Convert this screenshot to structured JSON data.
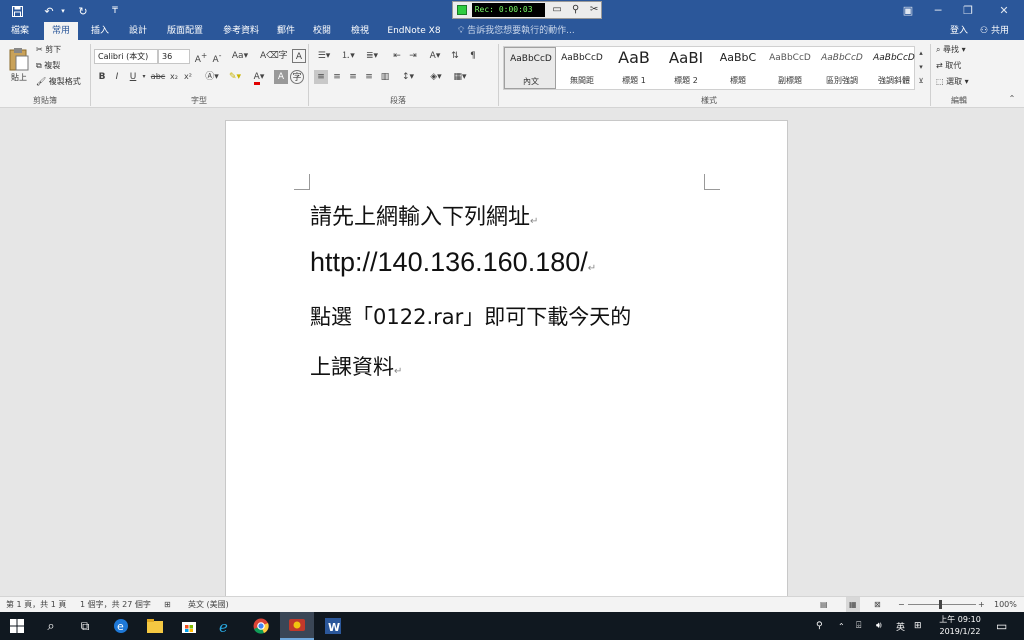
{
  "titlebar": {
    "rec_label": "Rec: 0:00:03",
    "win_min": "─",
    "win_restore": "❐",
    "win_close": "✕"
  },
  "tabs": {
    "items": [
      "檔案",
      "常用",
      "插入",
      "設計",
      "版面配置",
      "參考資料",
      "郵件",
      "校閱",
      "檢視",
      "EndNote X8"
    ],
    "active_index": 1,
    "tellme": "告訴我您想要執行的動作...",
    "signin": "登入",
    "share": "共用"
  },
  "ribbon": {
    "clipboard": {
      "paste": "貼上",
      "cut": "剪下",
      "copy": "複製",
      "format_painter": "複製格式",
      "label": "剪貼簿"
    },
    "font": {
      "name": "Calibri (本文)",
      "size": "36",
      "label": "字型"
    },
    "paragraph": {
      "label": "段落"
    },
    "styles": {
      "label": "樣式",
      "items": [
        {
          "preview": "AaBbCcD",
          "name": "內文"
        },
        {
          "preview": "AaBbCcD",
          "name": "無間距"
        },
        {
          "preview": "AaB",
          "name": "標題 1"
        },
        {
          "preview": "AaBI",
          "name": "標題 2"
        },
        {
          "preview": "AaBbC",
          "name": "標題"
        },
        {
          "preview": "AaBbCcD",
          "name": "副標題"
        },
        {
          "preview": "AaBbCcD",
          "name": "區別強調"
        },
        {
          "preview": "AaBbCcD",
          "name": "強調斜體"
        }
      ]
    },
    "editing": {
      "find": "尋找",
      "replace": "取代",
      "select": "選取",
      "label": "編輯"
    }
  },
  "document": {
    "lines": [
      "請先上網輸入下列網址",
      "http://140.136.160.180/",
      "點選「0122.rar」即可下載今天的",
      "上課資料"
    ]
  },
  "statusbar": {
    "page": "第 1 頁，共 1 頁",
    "words": "1 個字，共 27 個字",
    "lang": "英文 (美國)",
    "zoom": "100%"
  },
  "taskbar": {
    "time": "上午 09:10",
    "date": "2019/1/22",
    "ime": "英"
  },
  "colors": {
    "word_blue": "#2b579a",
    "ribbon_bg": "#f3f3f3",
    "taskbar": "#101820"
  }
}
